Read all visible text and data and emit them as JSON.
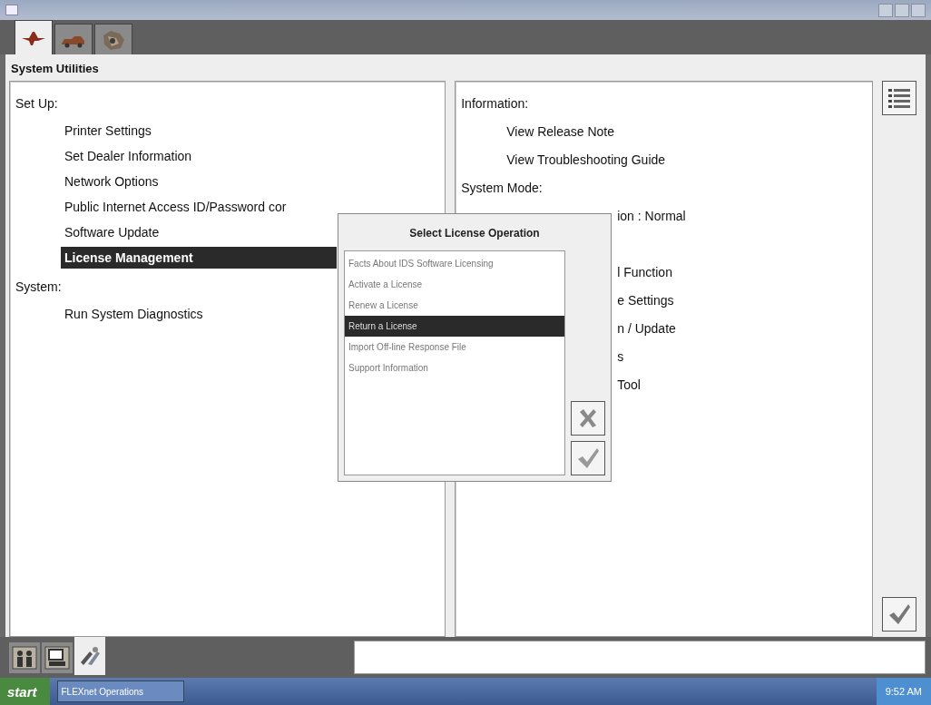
{
  "toolbar_tabs": [
    {
      "kind": "connector",
      "selected": true
    },
    {
      "kind": "car",
      "selected": false
    },
    {
      "kind": "engine",
      "selected": false
    }
  ],
  "heading": "System Utilities",
  "left_panel": [
    {
      "title": "Set Up:",
      "items": [
        {
          "label": "Printer Settings",
          "selected": false
        },
        {
          "label": "Set Dealer Information",
          "selected": false
        },
        {
          "label": "Network Options",
          "selected": false
        },
        {
          "label": "Public Internet Access ID/Password cor",
          "selected": false
        },
        {
          "label": "Software Update",
          "selected": false
        },
        {
          "label": "License Management",
          "selected": true
        }
      ]
    },
    {
      "title": "System:",
      "items": [
        {
          "label": "Run System Diagnostics",
          "selected": false
        }
      ]
    }
  ],
  "right_panel": {
    "title": "Information:",
    "items": [
      "View Release Note",
      "View Troubleshooting Guide"
    ],
    "mode_title": "System Mode:",
    "mode_fragments": [
      "ion : Normal"
    ],
    "tool_fragments": [
      "l Function",
      "e Settings",
      "n / Update",
      "s",
      "Tool"
    ]
  },
  "dialog": {
    "title": "Select License Operation",
    "options": [
      {
        "label": "Facts About IDS Software Licensing",
        "selected": false
      },
      {
        "label": "Activate a License",
        "selected": false
      },
      {
        "label": "Renew a License",
        "selected": false
      },
      {
        "label": "Return a License",
        "selected": true
      },
      {
        "label": "Import Off-line Response File",
        "selected": false
      },
      {
        "label": "Support Information",
        "selected": false
      }
    ]
  },
  "bottom_tabs": [
    {
      "kind": "people",
      "selected": false
    },
    {
      "kind": "monitor",
      "selected": false
    },
    {
      "kind": "tools",
      "selected": true
    }
  ],
  "taskbar": {
    "start": "start",
    "items": [
      {
        "label": "FLEXnet Operations"
      }
    ],
    "clock": "9:52 AM"
  }
}
